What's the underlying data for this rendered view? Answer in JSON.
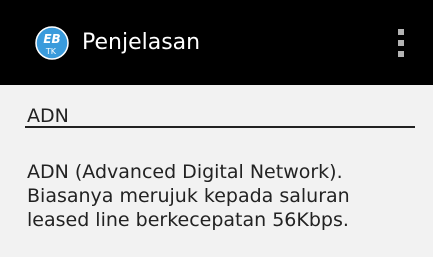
{
  "action_bar": {
    "app_icon": {
      "name": "ebtk-app-icon",
      "letters_top": "EB",
      "letters_bottom": "TK",
      "color": "#3a9bdc"
    },
    "title": "Penjelasan",
    "overflow_icon": "overflow-menu-icon"
  },
  "content": {
    "term": "ADN",
    "explanation": "ADN (Advanced Digital Network). Biasanya merujuk kepada saluran leased line berkecepatan 56Kbps."
  },
  "colors": {
    "action_bar_bg": "#000000",
    "content_bg": "#f2f2f2",
    "text": "#222222"
  }
}
